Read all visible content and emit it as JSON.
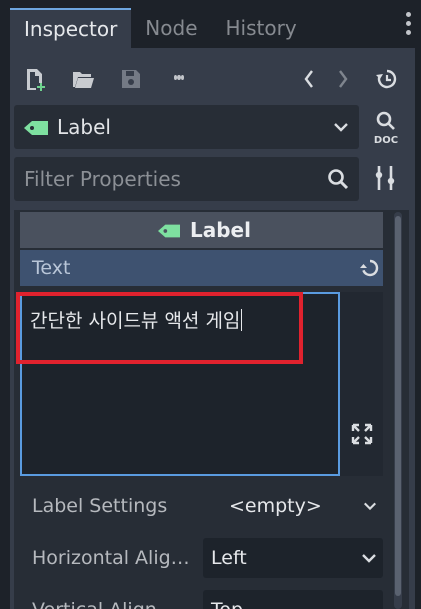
{
  "tabs": [
    {
      "label": "Inspector",
      "active": true
    },
    {
      "label": "Node",
      "active": false
    },
    {
      "label": "History",
      "active": false
    }
  ],
  "toolbar": {
    "icons": [
      "new-resource-icon",
      "open-folder-icon",
      "save-icon",
      "more-options-icon",
      "back-arrow-icon",
      "forward-arrow-icon",
      "history-icon"
    ]
  },
  "node_selector": {
    "value": "Label",
    "icon": "label-tag-icon",
    "doc_button": "DOC"
  },
  "filter": {
    "placeholder": "Filter Properties"
  },
  "category": {
    "title": "Label"
  },
  "text_property": {
    "label": "Text",
    "value": "간단한 사이드뷰 액션 게임"
  },
  "rows": [
    {
      "label": "Label Settings",
      "value": "<empty>"
    },
    {
      "label": "Horizontal Alig…",
      "value": "Left"
    },
    {
      "label": "Vertical Align…",
      "value": "Top"
    }
  ],
  "colors": {
    "accent": "#6ea6e0",
    "tag_green": "#7ee0a0",
    "highlight_red": "#e0222e",
    "property_header": "#3e5270"
  }
}
